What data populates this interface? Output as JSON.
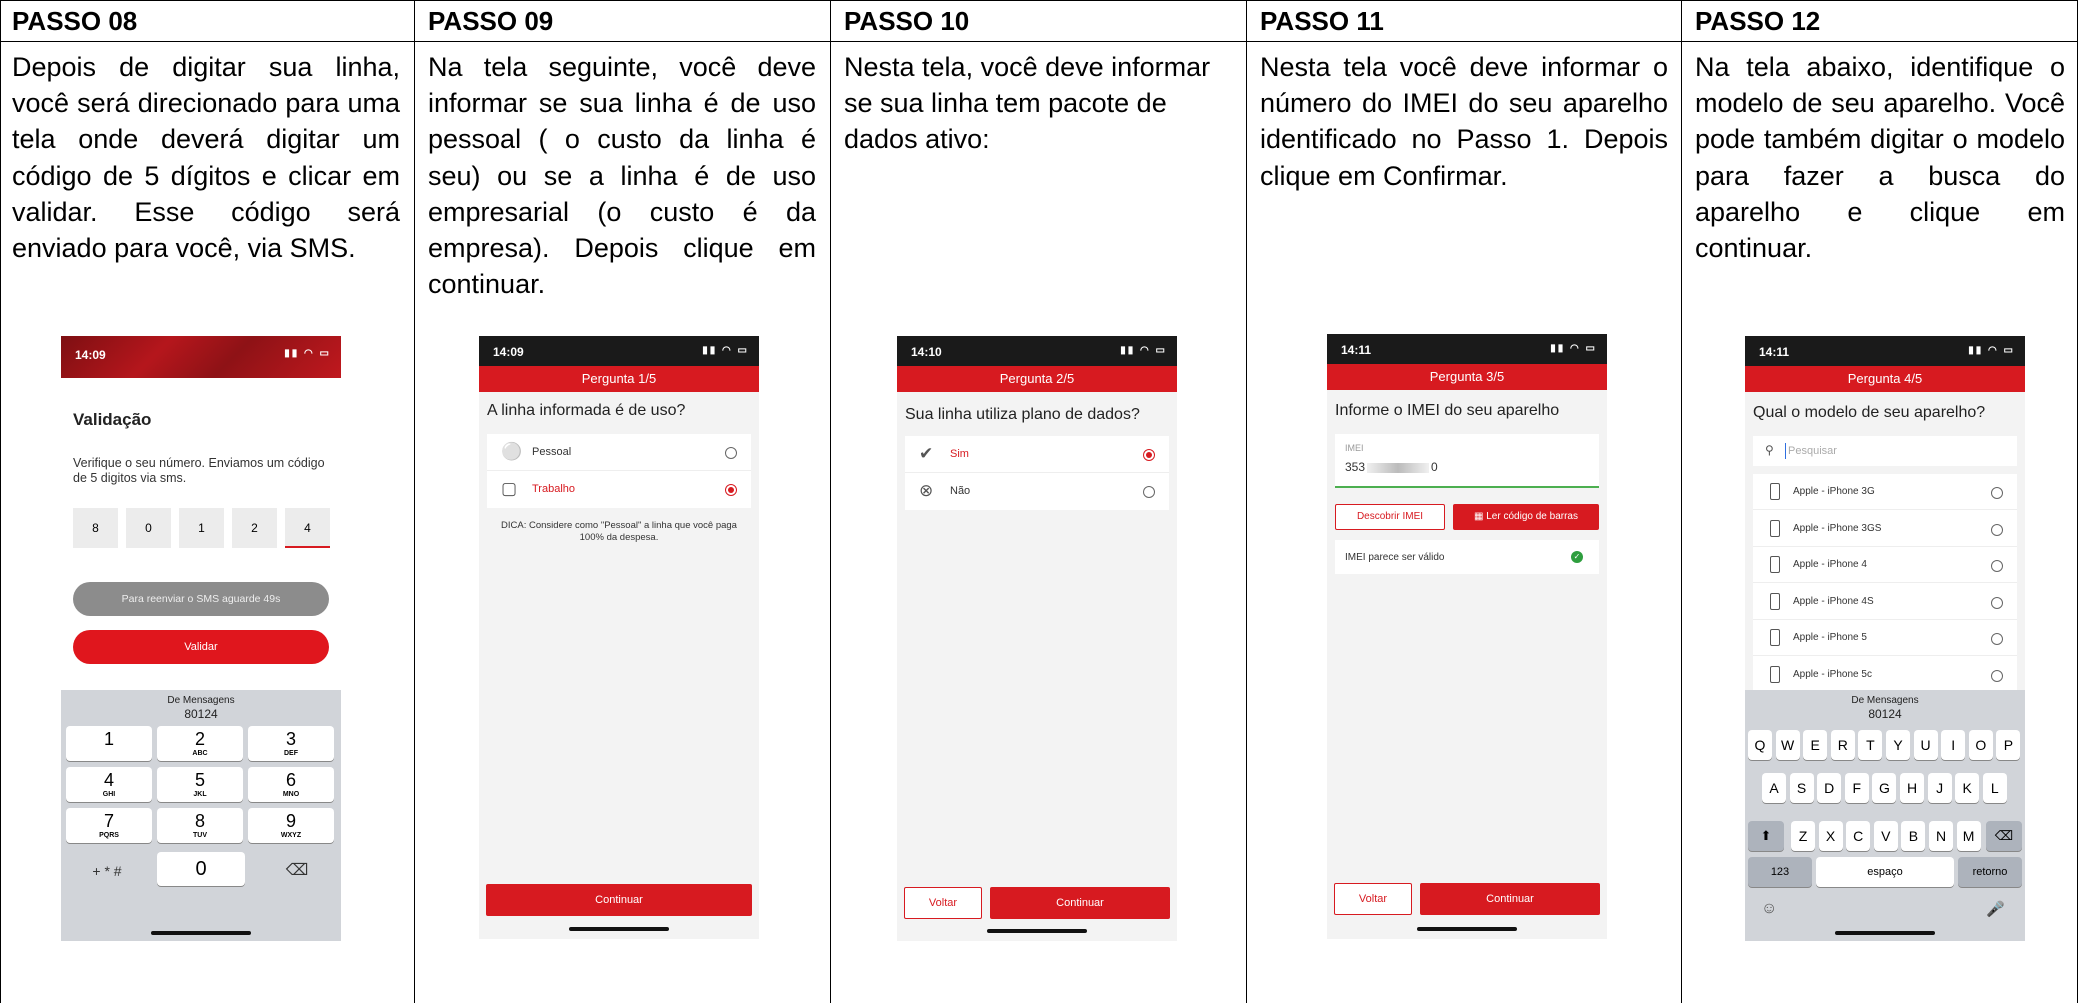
{
  "steps": [
    {
      "title": "PASSO 08",
      "text": "Depois de digitar sua linha, você será direcionado para uma tela onde deverá digitar um código de 5 dígitos e clicar em validar. Esse código será enviado para você, via SMS."
    },
    {
      "title": "PASSO 09",
      "text": "Na tela seguinte, você deve informar se sua linha é de uso pessoal ( o custo da linha é seu) ou se a linha é de uso empresarial (o custo é da empresa). Depois clique em continuar."
    },
    {
      "title": "PASSO 10",
      "text": "Nesta tela, você deve informar se sua linha tem pacote de dados ativo:"
    },
    {
      "title": "PASSO 11",
      "text": "Nesta tela você deve informar o número do IMEI do seu aparelho identificado no Passo 1. Depois clique em Confirmar."
    },
    {
      "title": "PASSO 12",
      "text": "Na tela abaixo, identifique o modelo de seu aparelho. Você pode também digitar o modelo para fazer a busca do aparelho e clique em continuar."
    }
  ],
  "colors": {
    "brand_red": "#d71a20"
  },
  "screen08": {
    "time": "14:09",
    "title": "Validação",
    "subtitle": "Verifique o seu número. Enviamos um código de 5 digitos via sms.",
    "digits": [
      "8",
      "0",
      "1",
      "2",
      "4"
    ],
    "resend_label": "Para reenviar o SMS aguarde 49s",
    "validate_label": "Validar",
    "sms_from": "De Mensagens",
    "sms_code": "80124",
    "keys": [
      {
        "n": "1",
        "l": ""
      },
      {
        "n": "2",
        "l": "ABC"
      },
      {
        "n": "3",
        "l": "DEF"
      },
      {
        "n": "4",
        "l": "GHI"
      },
      {
        "n": "5",
        "l": "JKL"
      },
      {
        "n": "6",
        "l": "MNO"
      },
      {
        "n": "7",
        "l": "PQRS"
      },
      {
        "n": "8",
        "l": "TUV"
      },
      {
        "n": "9",
        "l": "WXYZ"
      }
    ],
    "key_symbols": "+ * #",
    "key_zero": "0",
    "key_delete": "⌫"
  },
  "screen09": {
    "time": "14:09",
    "header": "Pergunta 1/5",
    "question": "A linha informada é de uso?",
    "options": [
      {
        "label": "Pessoal",
        "icon": "person-icon",
        "selected": false
      },
      {
        "label": "Trabalho",
        "icon": "briefcase-icon",
        "selected": true
      }
    ],
    "tip": "DICA: Considere como \"Pessoal\" a linha que você paga 100% da despesa.",
    "continue_label": "Continuar"
  },
  "screen10": {
    "time": "14:10",
    "header": "Pergunta 2/5",
    "question": "Sua linha utiliza plano de dados?",
    "options": [
      {
        "label": "Sim",
        "icon": "check-circle-icon",
        "selected": true
      },
      {
        "label": "Não",
        "icon": "x-circle-icon",
        "selected": false
      }
    ],
    "back_label": "Voltar",
    "continue_label": "Continuar"
  },
  "screen11": {
    "time": "14:11",
    "header": "Pergunta 3/5",
    "question": "Informe o IMEI do seu aparelho",
    "imei_label": "IMEI",
    "imei_start": "353",
    "imei_end": "0",
    "discover_label": "Descobrir IMEI",
    "barcode_label": "Ler código de barras",
    "valid_text": "IMEI parece ser válido",
    "back_label": "Voltar",
    "continue_label": "Continuar"
  },
  "screen12": {
    "time": "14:11",
    "header": "Pergunta 4/5",
    "question": "Qual o modelo de seu aparelho?",
    "search_placeholder": "Pesquisar",
    "models": [
      "Apple - iPhone 3G",
      "Apple - iPhone 3GS",
      "Apple - iPhone 4",
      "Apple - iPhone 4S",
      "Apple - iPhone 5",
      "Apple - iPhone 5c"
    ],
    "sms_from": "De Mensagens",
    "sms_code": "80124",
    "row1": [
      "Q",
      "W",
      "E",
      "R",
      "T",
      "Y",
      "U",
      "I",
      "O",
      "P"
    ],
    "row2": [
      "A",
      "S",
      "D",
      "F",
      "G",
      "H",
      "J",
      "K",
      "L"
    ],
    "row3": [
      "Z",
      "X",
      "C",
      "V",
      "B",
      "N",
      "M"
    ],
    "key_123": "123",
    "key_space": "espaço",
    "key_return": "retorno"
  }
}
